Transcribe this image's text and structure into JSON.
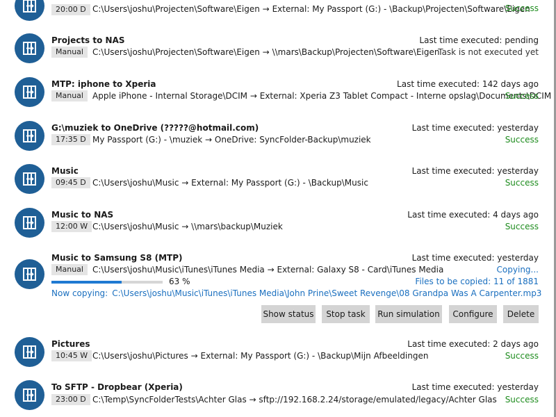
{
  "tasks": [
    {
      "name": "",
      "schedule": "20:00 D",
      "source": "C:\\Users\\joshu\\Projecten\\Software\\Eigen",
      "target": "External: My Passport (G:) - \\Backup\\Projecten\\Software\\Eigen",
      "last_executed": "",
      "status": "Success",
      "status_kind": "success"
    },
    {
      "name": "Projects to NAS",
      "schedule": "Manual",
      "source": "C:\\Users\\joshu\\Projecten\\Software\\Eigen",
      "target": "\\\\mars\\Backup\\Projecten\\Software\\Eigen",
      "last_executed": "Last time executed: pending",
      "status": "Task is not executed yet",
      "status_kind": "pending"
    },
    {
      "name": "MTP: iphone to Xperia",
      "schedule": "Manual",
      "source": "Apple iPhone - Internal Storage\\DCIM",
      "target": "External: Xperia Z3 Tablet Compact - Interne opslag\\Documents\\DCIM",
      "last_executed": "Last time executed: 142 days ago",
      "status": "Success",
      "status_kind": "success"
    },
    {
      "name": "G:\\muziek to OneDrive (?????@hotmail.com)",
      "schedule": "17:35 D",
      "source": "My Passport (G:) - \\muziek",
      "target": "OneDrive: SyncFolder-Backup\\muziek",
      "last_executed": "Last time executed: yesterday",
      "status": "Success",
      "status_kind": "success"
    },
    {
      "name": "Music",
      "schedule": "09:45 D",
      "source": "C:\\Users\\joshu\\Music",
      "target": "External: My Passport (G:) - \\Backup\\Music",
      "last_executed": "Last time executed: yesterday",
      "status": "Success",
      "status_kind": "success"
    },
    {
      "name": "Music to NAS",
      "schedule": "12:00 W",
      "source": "C:\\Users\\joshu\\Music",
      "target": "\\\\mars\\backup\\Muziek",
      "last_executed": "Last time executed: 4 days ago",
      "status": "Success",
      "status_kind": "success"
    },
    {
      "name": "Music to Samsung S8 (MTP)",
      "schedule": "Manual",
      "source": "C:\\Users\\joshu\\Music\\iTunes\\iTunes Media",
      "target": "External: Galaxy S8 - Card\\iTunes Media",
      "last_executed": "Last time executed: yesterday",
      "status": "Copying...",
      "status_kind": "copying"
    },
    {
      "name": "Pictures",
      "schedule": "10:45 W",
      "source": "C:\\Users\\joshu\\Pictures",
      "target": "External: My Passport (G:) - \\Backup\\Mijn Afbeeldingen",
      "last_executed": "Last time executed: 2 days ago",
      "status": "Success",
      "status_kind": "success"
    },
    {
      "name": "To SFTP - Dropbear (Xperia)",
      "schedule": "23:00 D",
      "source": "C:\\Temp\\SyncFolderTests\\Achter Glas",
      "target": "sftp://192.168.2.24/storage/emulated/legacy/Achter Glas",
      "last_executed": "Last time executed: yesterday",
      "status": "Success",
      "status_kind": "success"
    }
  ],
  "arrow": "→",
  "active_task": {
    "progress_percent": 63,
    "progress_label": "63 %",
    "files_to_copy": "Files to be copied: 11 of 1881",
    "now_copying_label": "Now copying:",
    "now_copying_path": "C:\\Users\\joshu\\Music\\iTunes\\iTunes Media\\John Prine\\Sweet Revenge\\08 Grandpa Was A Carpenter.mp3",
    "buttons": {
      "show_status": "Show status",
      "stop_task": "Stop task",
      "run_simulation": "Run simulation",
      "configure": "Configure",
      "delete": "Delete"
    }
  },
  "icon": "sync-task-icon",
  "colors": {
    "icon_bg": "#1f5f96",
    "success": "#1e8c1e",
    "link": "#1a6fbf",
    "progress": "#1f7ad2",
    "badge_bg": "#e4e4e4",
    "button_bg": "#d4d4d4"
  }
}
